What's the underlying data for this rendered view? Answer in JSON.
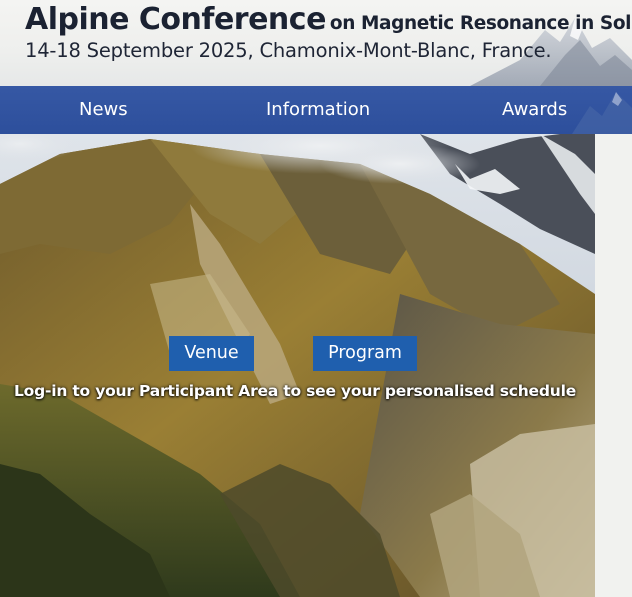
{
  "header": {
    "title": "Alpine Conference",
    "subtitle": "on Magnetic Resonance in Solids",
    "dates_location": "14-18 September 2025, Chamonix-Mont-Blanc, France."
  },
  "nav": {
    "items": [
      {
        "label": "News"
      },
      {
        "label": "Information"
      },
      {
        "label": "Awards"
      }
    ]
  },
  "hero": {
    "buttons": {
      "venue": "Venue",
      "program": "Program"
    },
    "note": "Log-in to your Participant Area to see your personalised schedule"
  },
  "colors": {
    "nav_background": "#2f52a0",
    "button_background": "#1f5fae",
    "title_text": "#1b2232"
  },
  "icons": {
    "header_background": "mountain-peaks-image",
    "hero_background": "alpine-valley-photo"
  }
}
